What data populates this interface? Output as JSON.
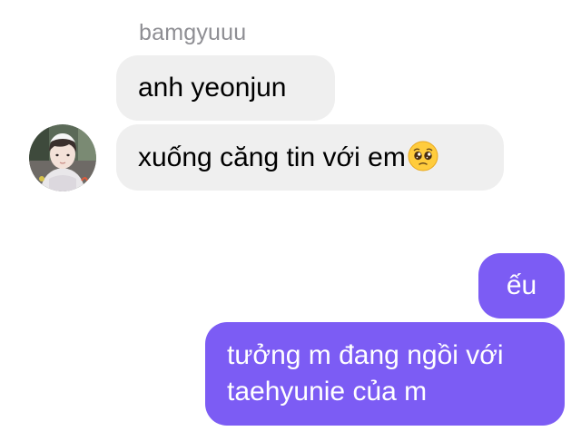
{
  "thread": {
    "sender_name": "bamgyuuu",
    "incoming": [
      {
        "text": "anh yeonjun"
      },
      {
        "text": "xuống căng tin với em",
        "emoji": "pleading-face-emoji"
      }
    ],
    "outgoing": [
      {
        "text": "ếu"
      },
      {
        "text": "tưởng m đang ngồi với taehyunie của m"
      }
    ]
  },
  "colors": {
    "incoming_bubble": "#efefef",
    "outgoing_bubble": "#7c5cf4",
    "sender_name": "#8e8e93"
  },
  "avatar": {
    "icon": "user-avatar-photo"
  }
}
